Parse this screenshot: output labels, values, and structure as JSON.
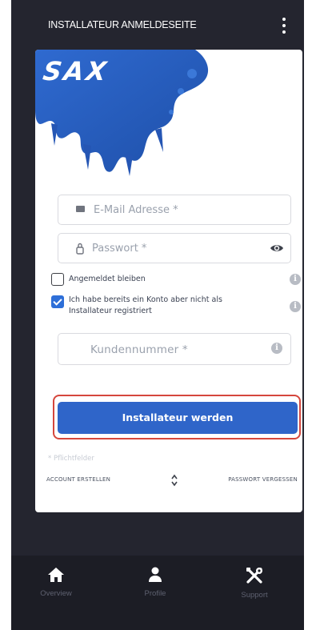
{
  "header": {
    "title": "INSTALLATEUR ANMELDESEITE",
    "menu_icon": "more-vert-icon"
  },
  "brand": {
    "logo_text": "SAX",
    "logo_color": "#2f65c9"
  },
  "form": {
    "email_placeholder": "E-Mail Adresse *",
    "password_placeholder": "Passwort *",
    "remember_label": "Angemeldet bleiben",
    "remember_checked": false,
    "has_account_label": "Ich habe bereits ein Konto aber nicht als Installateur registriert",
    "has_account_checked": true,
    "customer_number_placeholder": "Kundennummer *",
    "info_glyph": "i"
  },
  "actions": {
    "submit_label": "Installateur werden",
    "required_note": "* Pflichtfelder",
    "create_account": "ACCOUNT ERSTELLEN",
    "forgot_password": "PASSWORT VERGESSEN"
  },
  "tabs": [
    {
      "label": "Overview",
      "icon": "home-icon"
    },
    {
      "label": "Profile",
      "icon": "person-icon"
    },
    {
      "label": "Support",
      "icon": "tools-icon"
    }
  ],
  "colors": {
    "background": "#24252f",
    "primary": "#2f65c9",
    "highlight": "#d5463c"
  }
}
